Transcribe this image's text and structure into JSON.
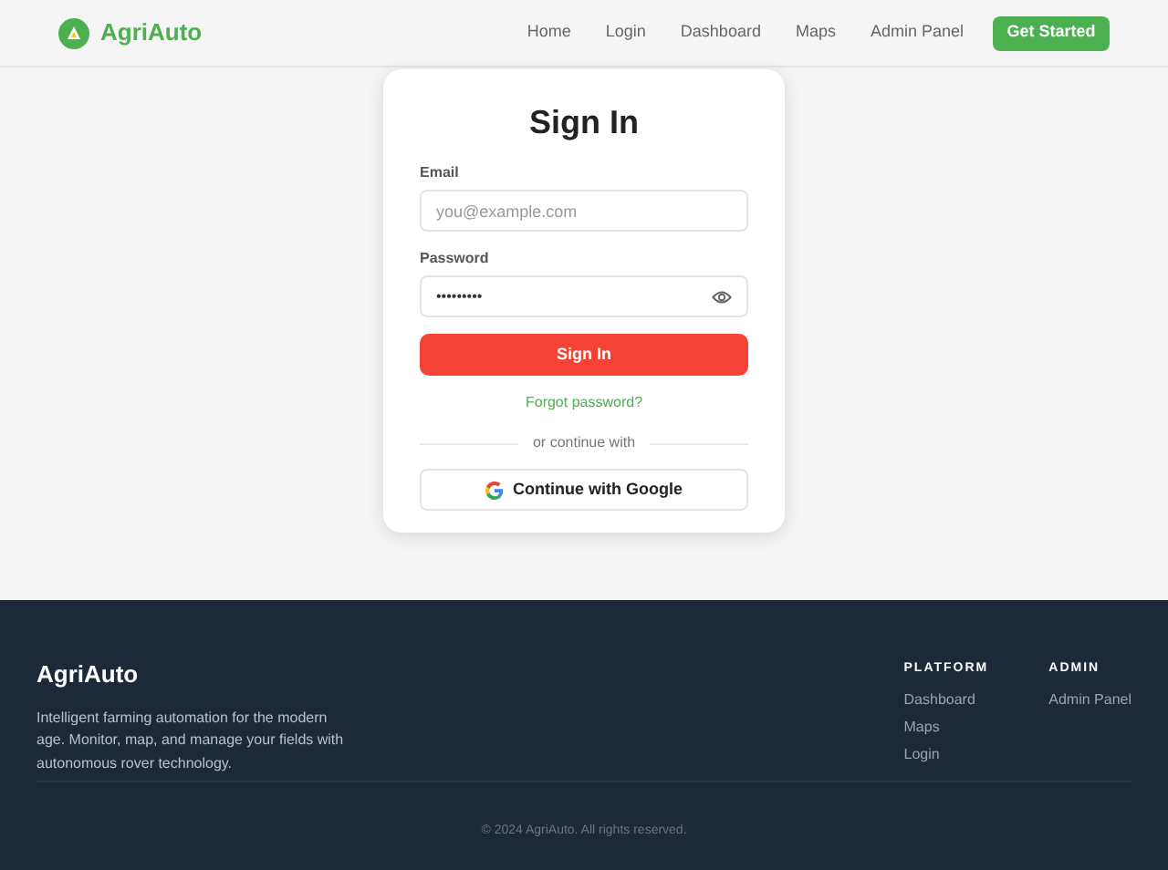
{
  "header": {
    "brand": "AgriAuto",
    "nav": [
      {
        "label": "Home"
      },
      {
        "label": "Login"
      },
      {
        "label": "Dashboard"
      },
      {
        "label": "Maps"
      },
      {
        "label": "Admin Panel"
      }
    ],
    "cta": "Get Started"
  },
  "signin": {
    "title": "Sign In",
    "email": {
      "label": "Email",
      "placeholder": "you@example.com"
    },
    "password": {
      "label": "Password",
      "value": "•••••••••"
    },
    "submit": "Sign In",
    "forgot": "Forgot password?",
    "divider": "or continue with",
    "google": "Continue with Google"
  },
  "footer": {
    "brand": "AgriAuto",
    "description": "Intelligent farming automation for the modern age. Monitor, map, and manage your fields with autonomous rover technology.",
    "columns": [
      {
        "heading": "PLATFORM",
        "links": [
          "Dashboard",
          "Maps",
          "Login"
        ]
      },
      {
        "heading": "ADMIN",
        "links": [
          "Admin Panel"
        ]
      }
    ],
    "copyright": "© 2024 AgriAuto. All rights reserved."
  }
}
